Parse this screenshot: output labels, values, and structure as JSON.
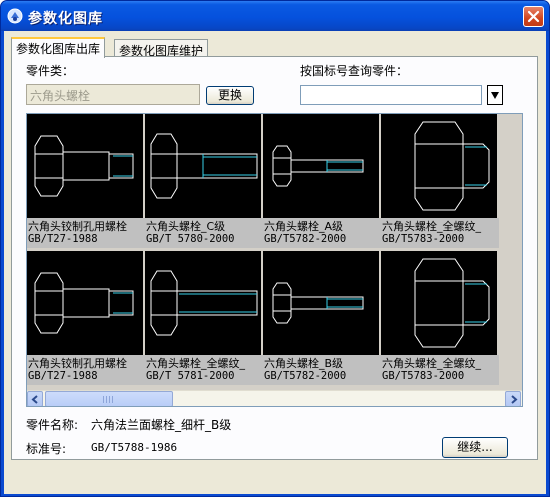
{
  "window": {
    "title": "参数化图库"
  },
  "tabs": [
    {
      "label": "参数化图库出库"
    },
    {
      "label": "参数化图库维护"
    }
  ],
  "part_class": {
    "label": "零件类：",
    "value": "六角头螺栓",
    "change_button": "更换"
  },
  "search": {
    "label": "按国标号查询零件：",
    "value": ""
  },
  "gallery": {
    "items": [
      {
        "name": "六角头铰制孔用螺栓",
        "code": "GB/T27-1988",
        "drawing": "reamed"
      },
      {
        "name": "六角头螺栓_C级",
        "code": "GB/T 5780-2000",
        "drawing": "c-grade"
      },
      {
        "name": "六角头螺栓_A级",
        "code": "GB/T5782-2000",
        "drawing": "a-grade"
      },
      {
        "name": "六角头螺栓_全螺纹_",
        "code": "GB/T5783-2000",
        "drawing": "full-thread"
      },
      {
        "name": "六角头铰制孔用螺栓",
        "code": "GB/T27-1988",
        "drawing": "reamed"
      },
      {
        "name": "六角头螺栓_全螺纹_",
        "code": "GB/T 5781-2000",
        "drawing": "full-thread-c"
      },
      {
        "name": "六角头螺栓_B级",
        "code": "GB/T5782-2000",
        "drawing": "a-grade"
      },
      {
        "name": "六角头螺栓_全螺纹_",
        "code": "GB/T5783-2000",
        "drawing": "full-thread"
      }
    ]
  },
  "selection": {
    "name_label": "零件名称:",
    "name_value": "六角法兰面螺栓_细杆_B级",
    "std_label": "标准号:",
    "std_value": "GB/T5788-1986"
  },
  "continue_button": "继续...",
  "colors": {
    "drawing_line": "#ffffff",
    "thread_line": "#38d0e8",
    "image_bg": "#000000"
  }
}
